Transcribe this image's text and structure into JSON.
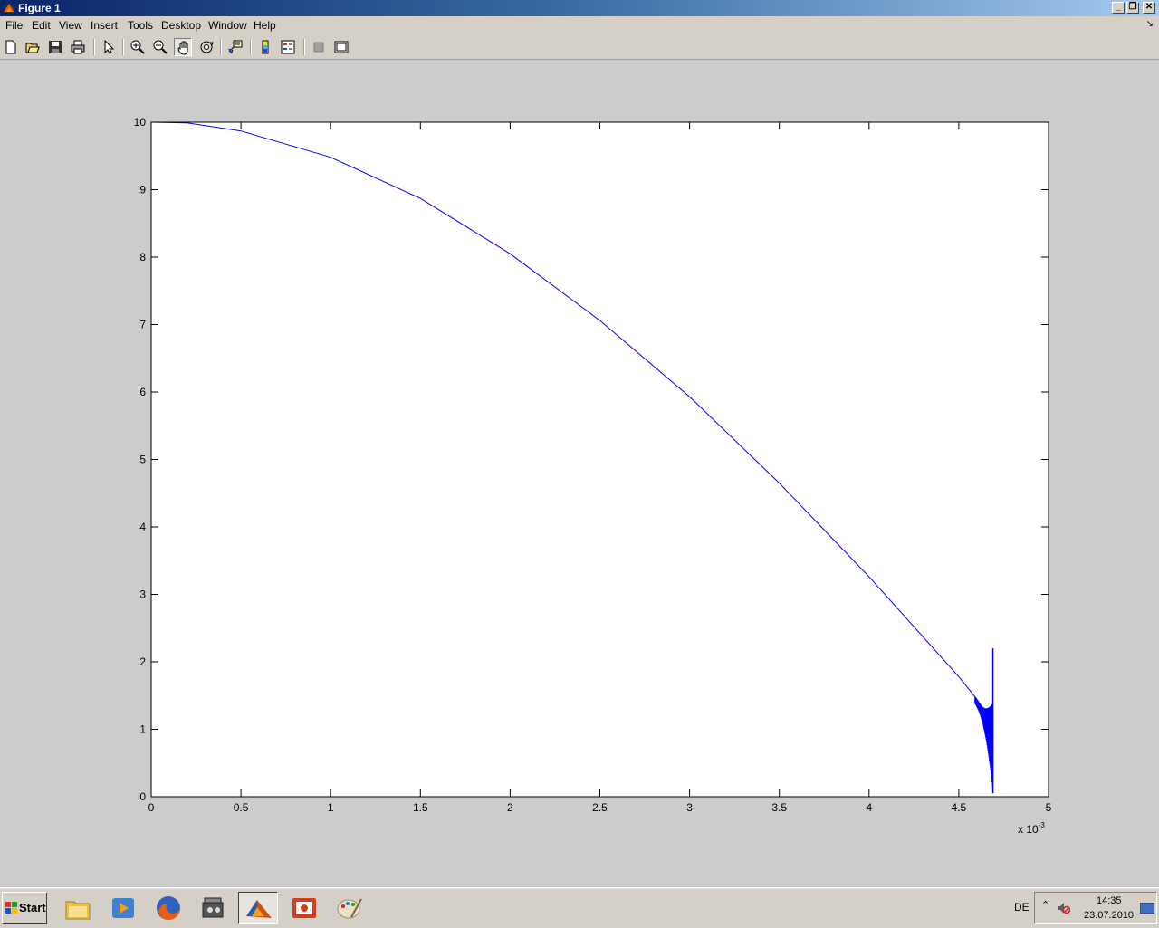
{
  "window": {
    "title": "Figure 1"
  },
  "menu": {
    "items": [
      "File",
      "Edit",
      "View",
      "Insert",
      "Tools",
      "Desktop",
      "Window",
      "Help"
    ]
  },
  "toolbar": {
    "buttons": [
      "new-figure-icon",
      "open-file-icon",
      "save-icon",
      "print-icon",
      "edit-plot-icon",
      "zoom-in-icon",
      "zoom-out-icon",
      "pan-hand-icon",
      "rotate-3d-icon",
      "data-cursor-icon",
      "colorbar-icon",
      "legend-icon",
      "hide-plot-tools-icon",
      "show-plot-tools-icon"
    ],
    "pressed": "pan-hand-icon"
  },
  "chart_data": {
    "type": "line",
    "title": "",
    "xlabel": "",
    "ylabel": "",
    "xlim": [
      0,
      0.005
    ],
    "ylim": [
      0,
      10
    ],
    "x_exponent_label": "x 10",
    "x_exponent_power": "-3",
    "xtick_labels": [
      "0",
      "0.5",
      "1",
      "1.5",
      "2",
      "2.5",
      "3",
      "3.5",
      "4",
      "4.5",
      "5"
    ],
    "ytick_labels": [
      "0",
      "1",
      "2",
      "3",
      "4",
      "5",
      "6",
      "7",
      "8",
      "9",
      "10"
    ],
    "grid": false,
    "series": [
      {
        "color": "#0000ff",
        "x": [
          0,
          0.0002,
          0.0005,
          0.001,
          0.0015,
          0.002,
          0.0025,
          0.003,
          0.0035,
          0.004,
          0.0045,
          0.0046,
          0.00465,
          0.00468,
          0.00469
        ],
        "y": [
          10,
          9.99,
          9.87,
          9.48,
          8.87,
          8.05,
          7.06,
          5.93,
          4.65,
          3.26,
          1.78,
          1.45,
          1.25,
          1.1,
          1.0
        ]
      }
    ],
    "oscillation_region": {
      "x_start": 0.00459,
      "x_end": 0.00469,
      "y_min": 0.05,
      "y_max": 2.2
    }
  },
  "taskbar": {
    "start_label": "Start",
    "apps": [
      "explorer-icon",
      "media-player-icon",
      "firefox-icon",
      "video-tool-icon",
      "matlab-icon",
      "presentation-icon",
      "paint-icon"
    ],
    "active_app": "matlab-icon",
    "language": "DE",
    "time": "14:35",
    "date": "23.07.2010"
  }
}
